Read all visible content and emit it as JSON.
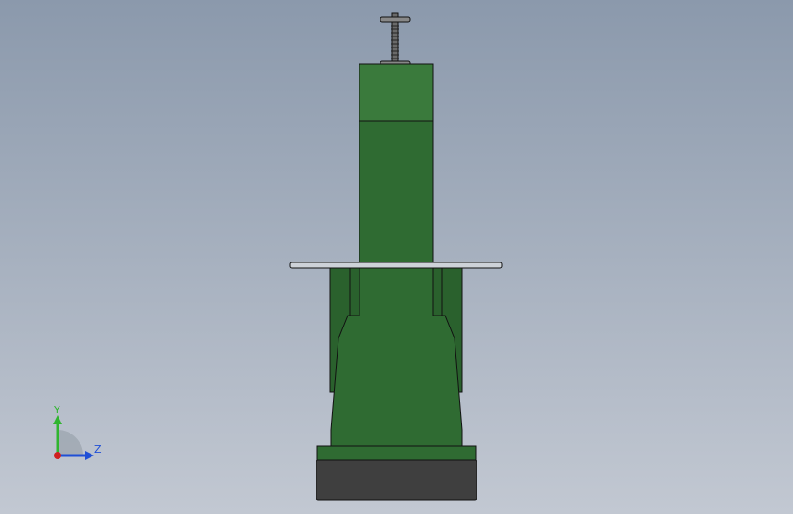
{
  "colors": {
    "background_top": "#8b99ac",
    "background_bottom": "#c2c8d2",
    "body_green": "#2f6b32",
    "body_green_dark": "#1f4d22",
    "base_dark": "#3f3f3f",
    "plate_light": "#cdd2d8",
    "axis_y": "#2fb52f",
    "axis_z": "#1f4fd6",
    "origin": "#d02020"
  },
  "model": {
    "name": "3d-model-viewport"
  },
  "triad": {
    "y_label": "Y",
    "z_label": "Z"
  }
}
